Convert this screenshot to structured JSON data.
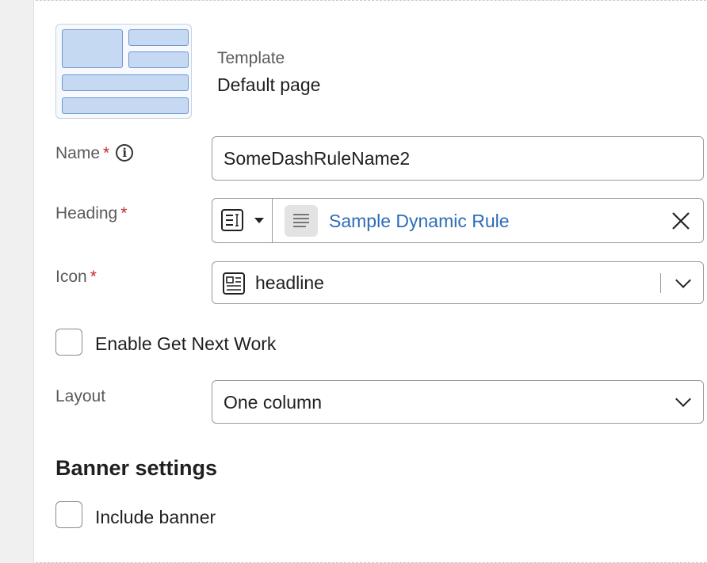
{
  "template": {
    "label": "Template",
    "value": "Default page"
  },
  "name_field": {
    "label": "Name",
    "required": "*",
    "info": "i",
    "value": "SomeDashRuleName2"
  },
  "heading_field": {
    "label": "Heading",
    "required": "*",
    "value": "Sample Dynamic Rule",
    "link_color": "#2f6db8"
  },
  "icon_field": {
    "label": "Icon",
    "required": "*",
    "value": "headline"
  },
  "get_next_work": {
    "label": "Enable Get Next Work",
    "checked": false
  },
  "layout_field": {
    "label": "Layout",
    "value": "One column"
  },
  "banner": {
    "title": "Banner settings",
    "include_label": "Include banner",
    "checked": false
  },
  "icons": {
    "template_preview": "layout-thumbnail-icon",
    "heading_mode": "text-box-icon",
    "rule": "document-lines-icon",
    "clear": "close-icon",
    "icon_preview": "newspaper-icon",
    "dropdown": "chevron-down-icon"
  }
}
